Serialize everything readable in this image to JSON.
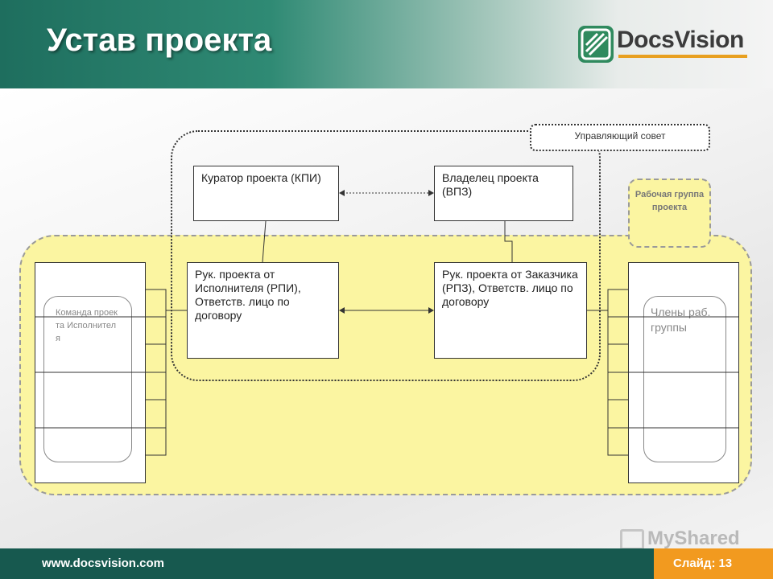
{
  "header": {
    "title": "Устав проекта"
  },
  "logo": {
    "text": "DocsVision"
  },
  "diagram": {
    "council_label": "Управляющий совет",
    "workgroup_label": "Рабочая группа проекта",
    "curator": "Куратор проекта (КПИ)",
    "owner": "Владелец проекта (ВПЗ)",
    "rpi": "Рук. проекта от Исполнителя (РПИ), Ответств. лицо по договору",
    "rpz": "Рук. проекта от Заказчика (РПЗ), Ответств. лицо по договору",
    "team_left": "Команда проекта Исполнителя",
    "team_right": "Члены раб. группы"
  },
  "footer": {
    "url": "www.docsvision.com",
    "slide_label": "Слайд:",
    "slide_number": "13"
  },
  "watermark": {
    "text": "MyShared"
  },
  "colors": {
    "header_green": "#1e6e5e",
    "footer_green": "#17594f",
    "accent_orange": "#f29a1f",
    "zone_yellow": "#fbf5a1"
  },
  "icons": [
    "docsvision-logo-icon",
    "myshared-watermark-icon"
  ]
}
